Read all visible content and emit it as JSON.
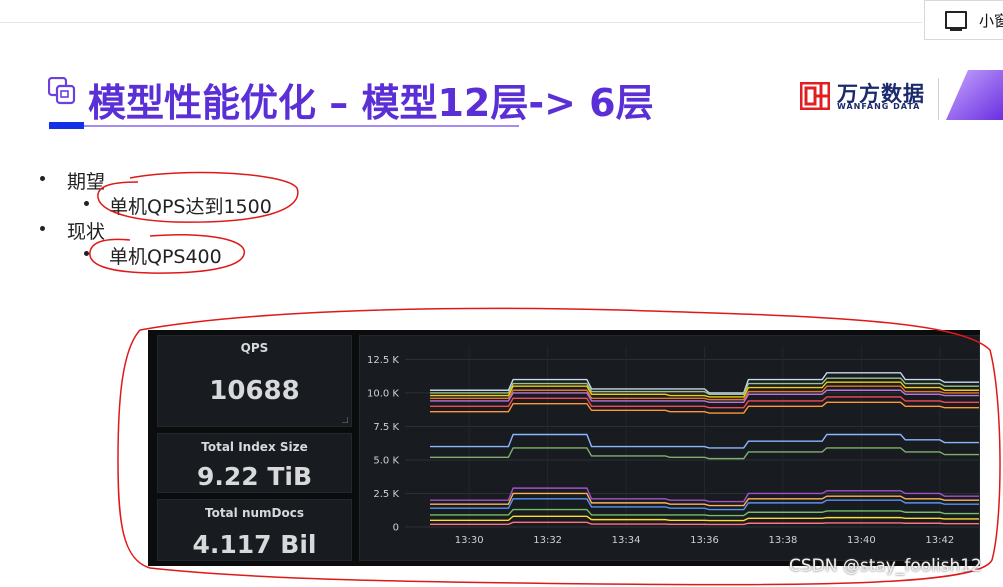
{
  "float_button": {
    "label": "小窗",
    "icon": "monitor-icon"
  },
  "slide": {
    "title": "模型性能优化 – 模型12层-> 6层",
    "logo": {
      "cn": "万方数据",
      "en": "WANFANG DATA"
    },
    "bullets": [
      {
        "label": "期望",
        "sub": [
          "单机QPS达到1500"
        ]
      },
      {
        "label": "现状",
        "sub": [
          "单机QPS400"
        ]
      }
    ]
  },
  "dashboard": {
    "stats": [
      {
        "label": "QPS",
        "value": "10688"
      },
      {
        "label": "Total Index Size",
        "value": "9.22 TiB"
      },
      {
        "label": "Total numDocs",
        "value": "4.117 Bil"
      }
    ],
    "chart_data": {
      "type": "line",
      "x": [
        "13:29",
        "13:30",
        "13:31",
        "13:32",
        "13:33",
        "13:34",
        "13:35",
        "13:36",
        "13:37",
        "13:38",
        "13:39",
        "13:40",
        "13:41",
        "13:42",
        "13:42.5"
      ],
      "yticks": [
        "12.5 K",
        "10.0 K",
        "7.5 K",
        "5.0 K",
        "2.5 K",
        "0"
      ],
      "xticks": [
        "13:30",
        "13:32",
        "13:34",
        "13:36",
        "13:38",
        "13:40",
        "13:42"
      ],
      "ylim": [
        0,
        13500
      ],
      "series": [
        {
          "color": "#c8d8f0",
          "values": [
            10200,
            10200,
            10200,
            11000,
            11000,
            10300,
            10300,
            10300,
            10000,
            11000,
            11000,
            11500,
            11500,
            11000,
            10800
          ]
        },
        {
          "color": "#9ac48a",
          "values": [
            10000,
            10000,
            10000,
            10700,
            10700,
            10100,
            10100,
            10100,
            9900,
            10700,
            10700,
            11100,
            11100,
            10700,
            10500
          ]
        },
        {
          "color": "#f2cc0c",
          "values": [
            9800,
            9800,
            9800,
            10500,
            10500,
            9900,
            9900,
            9800,
            9700,
            10400,
            10400,
            10800,
            10800,
            10400,
            10200
          ]
        },
        {
          "color": "#e0752d",
          "values": [
            9600,
            9600,
            9600,
            10200,
            10200,
            9600,
            9600,
            9600,
            9500,
            10100,
            10100,
            10500,
            10500,
            10100,
            10000
          ]
        },
        {
          "color": "#b877d9",
          "values": [
            9400,
            9400,
            9400,
            10000,
            10000,
            9400,
            9400,
            9400,
            9300,
            9900,
            9900,
            10200,
            10200,
            9900,
            9800
          ]
        },
        {
          "color": "#f2495c",
          "values": [
            9000,
            9000,
            9000,
            9600,
            9600,
            9000,
            9000,
            9000,
            8900,
            9400,
            9400,
            9700,
            9700,
            9400,
            9300
          ]
        },
        {
          "color": "#ff9830",
          "values": [
            8600,
            8600,
            8600,
            9200,
            9200,
            8700,
            8700,
            8600,
            8500,
            9000,
            9000,
            9300,
            9300,
            9000,
            8900
          ]
        },
        {
          "color": "#8ab8ff",
          "values": [
            6000,
            6000,
            6000,
            6900,
            6900,
            6000,
            6000,
            6000,
            5900,
            6400,
            6400,
            6900,
            6900,
            6500,
            6300
          ]
        },
        {
          "color": "#7eb26d",
          "values": [
            5200,
            5200,
            5200,
            5900,
            5900,
            5300,
            5300,
            5200,
            5100,
            5600,
            5600,
            5900,
            5900,
            5600,
            5400
          ]
        },
        {
          "color": "#a352cc",
          "values": [
            2000,
            2000,
            2000,
            2900,
            2900,
            2100,
            2100,
            2000,
            1900,
            2500,
            2500,
            2700,
            2700,
            2500,
            2300
          ]
        },
        {
          "color": "#ffb357",
          "values": [
            1700,
            1700,
            1700,
            2500,
            2500,
            1800,
            1800,
            1700,
            1600,
            2100,
            2100,
            2300,
            2300,
            2100,
            2000
          ]
        },
        {
          "color": "#5794f2",
          "values": [
            1400,
            1400,
            1400,
            2100,
            2100,
            1500,
            1500,
            1400,
            1300,
            1800,
            1800,
            2000,
            2000,
            1800,
            1700
          ]
        },
        {
          "color": "#73bf69",
          "values": [
            900,
            900,
            900,
            1300,
            1300,
            900,
            900,
            900,
            850,
            1100,
            1100,
            1200,
            1200,
            1100,
            1000
          ]
        },
        {
          "color": "#fade2a",
          "values": [
            500,
            500,
            500,
            800,
            800,
            550,
            550,
            500,
            480,
            650,
            650,
            700,
            700,
            650,
            600
          ]
        },
        {
          "color": "#ff7383",
          "values": [
            200,
            200,
            200,
            350,
            350,
            220,
            220,
            200,
            190,
            280,
            280,
            300,
            300,
            280,
            250
          ]
        }
      ]
    }
  },
  "watermark": "CSDN @stay_foolish12"
}
